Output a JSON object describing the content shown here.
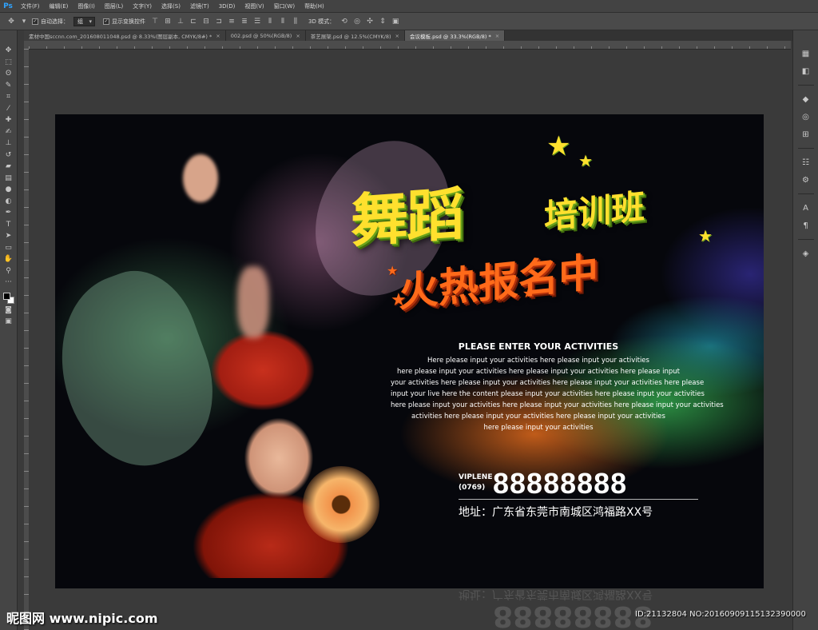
{
  "app": {
    "logo": "Ps"
  },
  "menu": [
    "文件(F)",
    "编辑(E)",
    "图像(I)",
    "图层(L)",
    "文字(Y)",
    "选择(S)",
    "滤镜(T)",
    "3D(D)",
    "视图(V)",
    "窗口(W)",
    "帮助(H)"
  ],
  "options": {
    "auto_select_label": "自动选择：",
    "auto_select_value": "组",
    "show_transform_label": "显示变换控件",
    "mode_3d_label": "3D 模式："
  },
  "tabs": [
    {
      "label": "素材中国sccnn.com_20160801104​8.psd @ 8.33%(图层副本, CMYK/8#) *",
      "active": false
    },
    {
      "label": "002.psd @ 50%(RGB/8)",
      "active": false
    },
    {
      "label": "茶艺展架.psd @ 12.5%(CMYK/8)",
      "active": false
    },
    {
      "label": "会议模板.psd @ 33.3%(RGB/8) *",
      "active": true
    }
  ],
  "poster": {
    "title_main": "舞蹈",
    "title_sub": "培训班",
    "title_signup": "火热报名中",
    "activities_heading": "PLEASE ENTER YOUR ACTIVITIES",
    "activities_lines": [
      "Here please input your activities here please input your activities",
      "here please input your activities here please input your activities here please input",
      "your activities here please input your activities here please input your activities here please",
      "input your live here the content please input your activities here please input your activities",
      "here please input your activities here please input your activities here please input your activities",
      "activities here please input your activities here please input your activities",
      "here please input your activities"
    ],
    "brand": "VIPLENE",
    "area_code": "(0769)",
    "phone": "88888888",
    "address": "地址：广东省东莞市南城区鸿福路XX号"
  },
  "watermark": "昵图网 www.nipic.com",
  "image_id": "ID:21132804 NO:20160909115132390000",
  "colors": {
    "accent_yellow": "#ffe02e",
    "accent_orange": "#ff6a1a",
    "ui_bg": "#3a3a3a"
  }
}
